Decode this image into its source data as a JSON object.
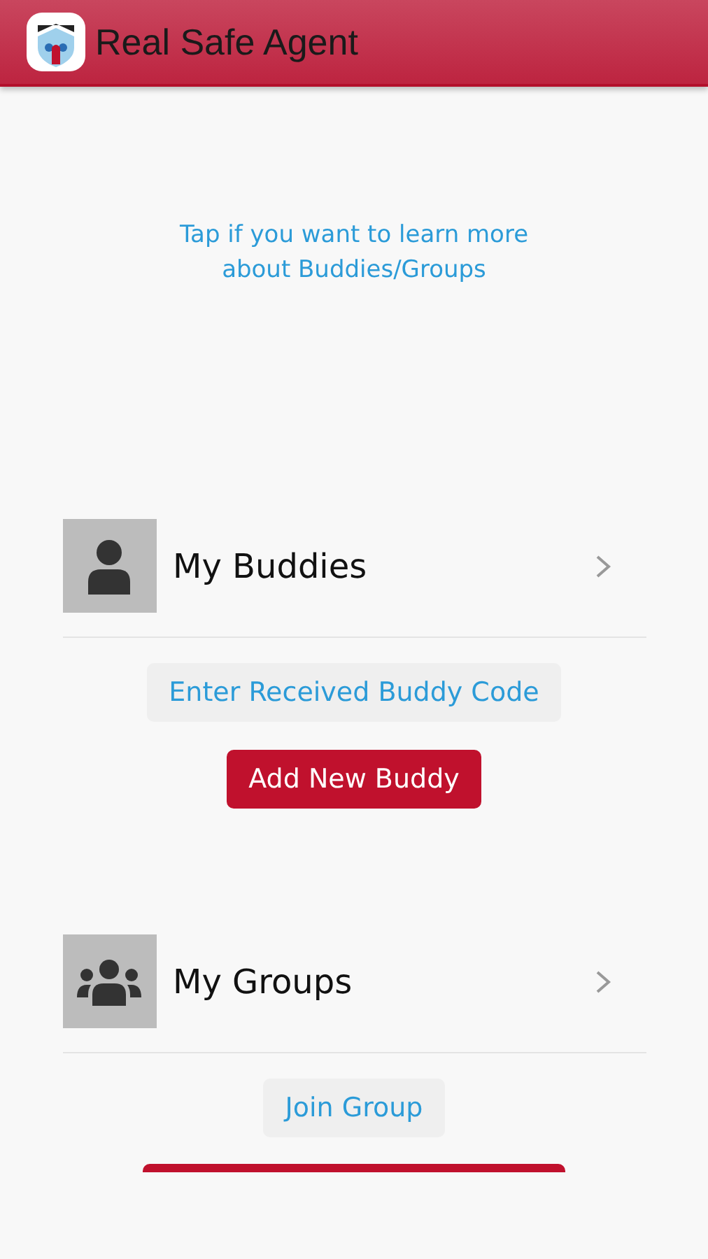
{
  "app_bar": {
    "title": "Real Safe Agent"
  },
  "info_link": "Tap if you want to learn more\nabout Buddies/Groups",
  "sections": [
    {
      "kind": "buddies",
      "title": "My Buddies",
      "actions": [
        {
          "kind": "light",
          "label": "Enter Received Buddy Code"
        },
        {
          "kind": "primary",
          "label": "Add New Buddy"
        }
      ]
    },
    {
      "kind": "groups",
      "title": "My Groups",
      "actions": [
        {
          "kind": "light",
          "label": "Join Group"
        },
        {
          "kind": "primary_cut"
        }
      ]
    }
  ]
}
